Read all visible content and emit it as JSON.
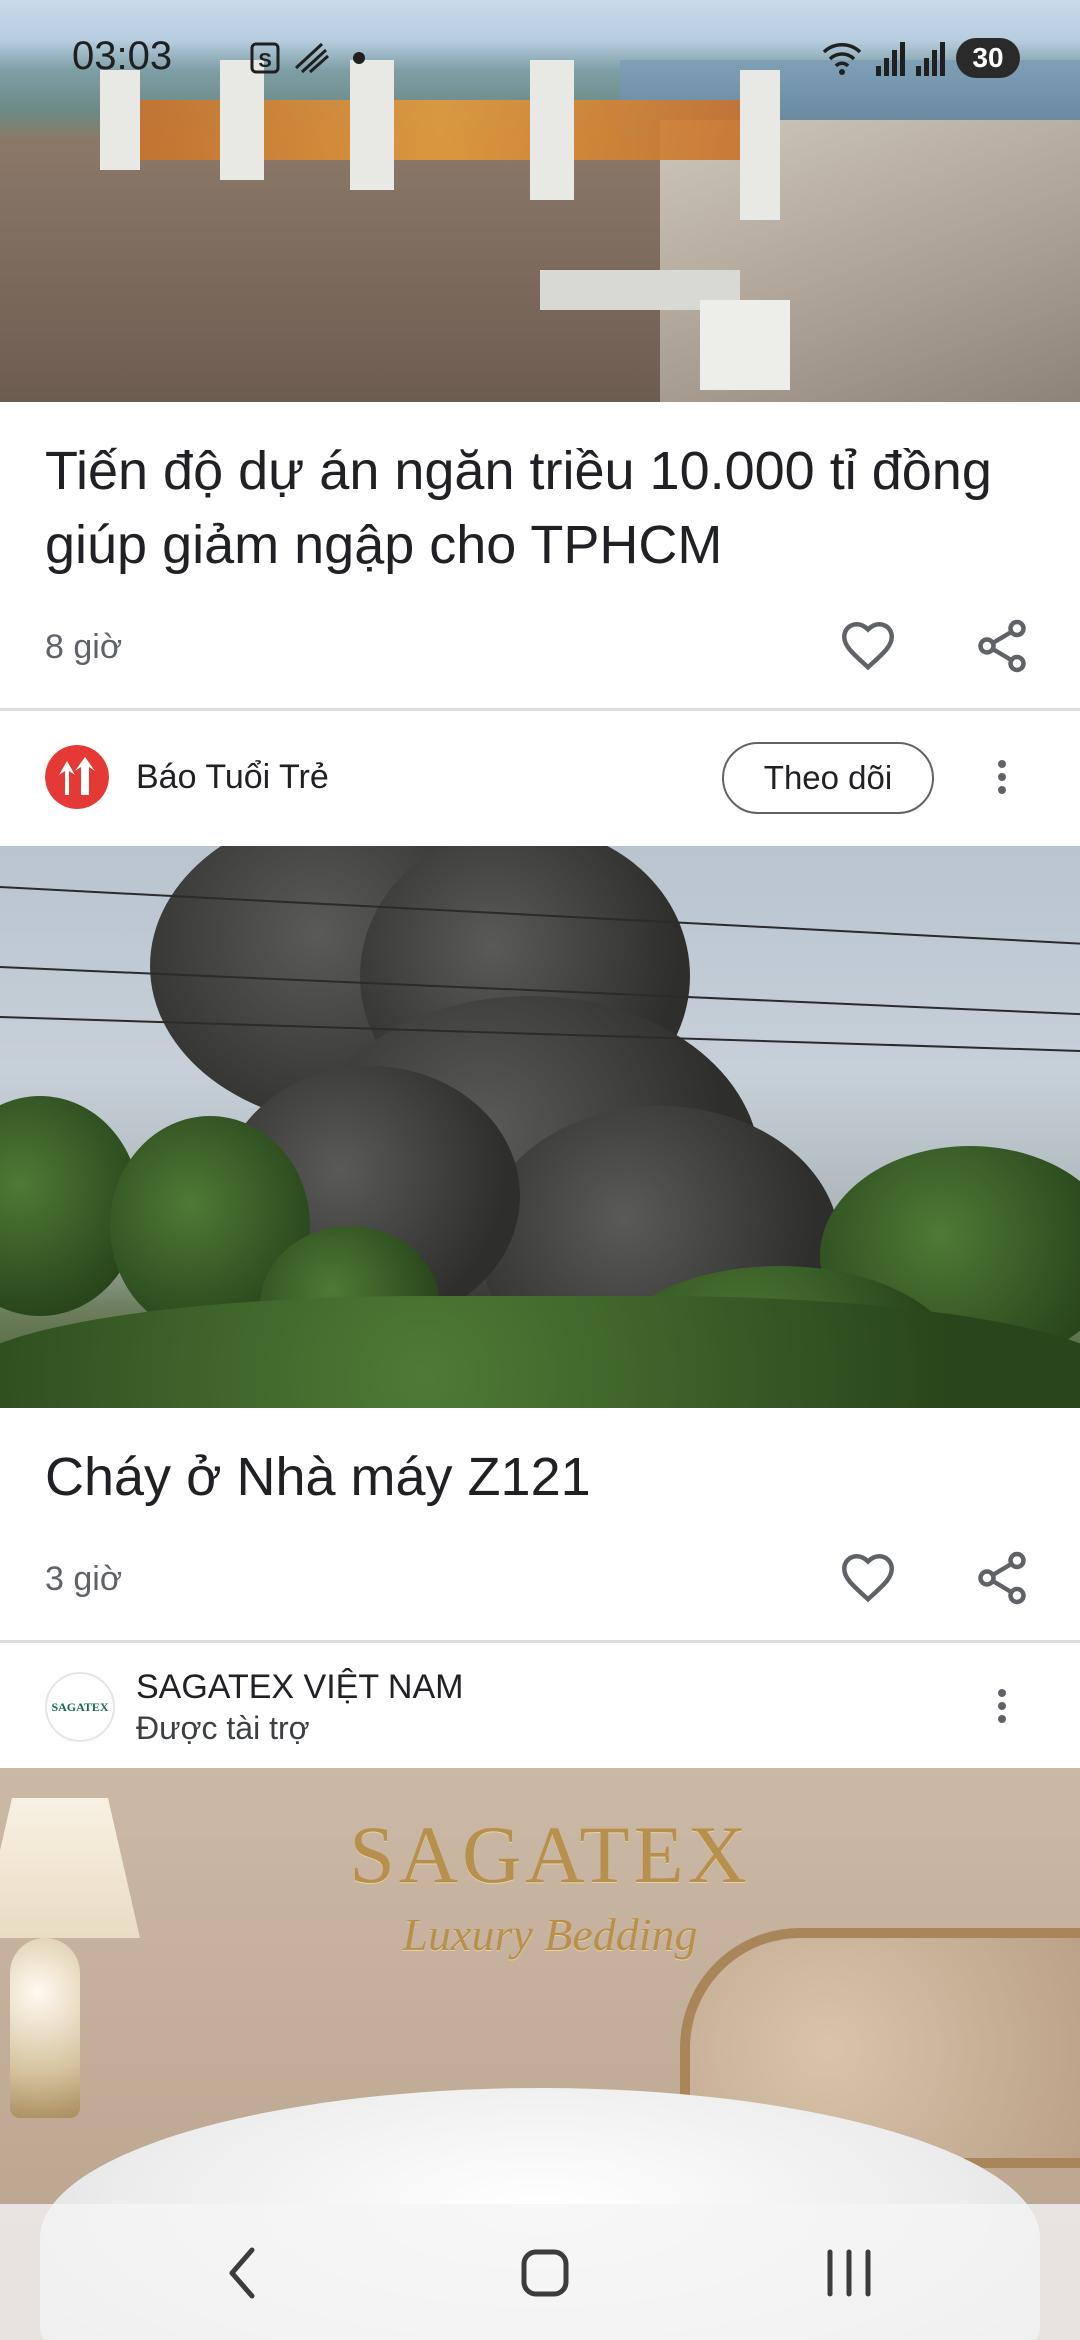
{
  "status_bar": {
    "time": "03:03",
    "battery": "30",
    "icons": [
      "cloud-moon-icon",
      "s-notification-icon",
      "signal-off-icon",
      "dot-icon",
      "wifi-icon",
      "signal-icon",
      "signal-icon"
    ]
  },
  "articles": [
    {
      "title": "Tiến độ dự án ngăn triều 10.000 tỉ đồng giúp giảm ngập cho TPHCM",
      "age": "8 giờ"
    },
    {
      "publisher": "Báo Tuổi Trẻ",
      "follow_label": "Theo dõi",
      "title": "Cháy ở Nhà máy Z121",
      "age": "3 giờ"
    }
  ],
  "ad": {
    "advertiser": "SAGATEX VIỆT NAM",
    "sponsored_label": "Được tài trợ",
    "logo_text": "SAGATEX",
    "brand_title": "SAGATEX",
    "brand_subtitle": "Luxury Bedding"
  },
  "nav": {
    "buttons": [
      "back-icon",
      "home-icon",
      "recents-icon"
    ]
  },
  "colors": {
    "publisher_logo": "#e53935",
    "divider": "#dadce0",
    "meta_text": "#5f6368",
    "brand_gold": "#b8904e"
  }
}
